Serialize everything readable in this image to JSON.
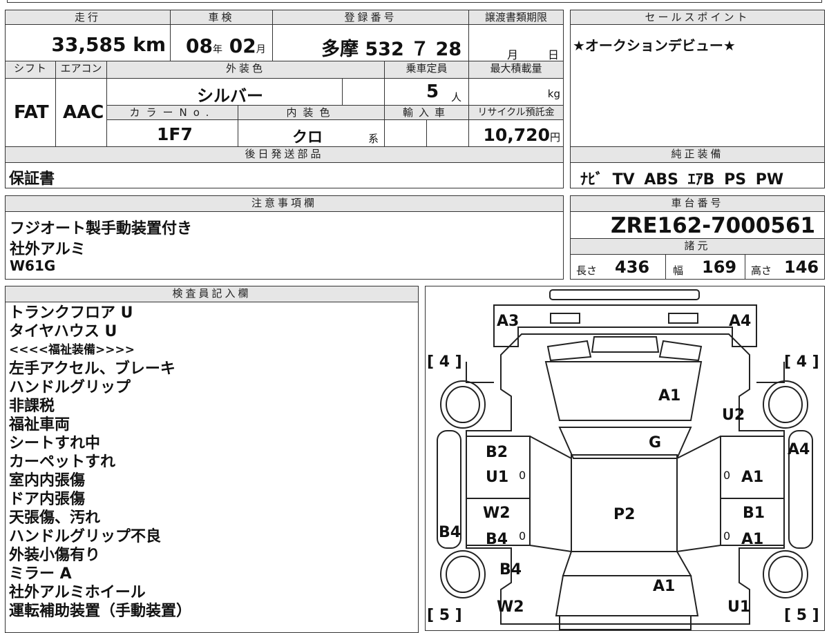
{
  "top": {
    "mileage_label": "走行",
    "mileage": "33,585",
    "mileage_unit": "km",
    "inspection_label": "車検",
    "inspection_year": "08",
    "inspection_year_unit": "年",
    "inspection_month": "02",
    "inspection_month_unit": "月",
    "registration_label": "登録番号",
    "registration": "多摩 532 ７ 28",
    "transfer_label": "譲渡書類期限",
    "transfer_month_unit": "月",
    "transfer_day_unit": "日",
    "sales_label": "セールスポイント",
    "sales_text": "★オークションデビュー★"
  },
  "row2": {
    "shift_label": "シフト",
    "shift": "FAT",
    "ac_label": "エアコン",
    "ac": "AAC",
    "exterior_color_label": "外装色",
    "exterior_color": "シルバー",
    "capacity_label": "乗車定員",
    "capacity": "5",
    "capacity_unit": "人",
    "max_load_label": "最大積載量",
    "max_load_unit": "kg",
    "color_no_label": "カラーNo.",
    "color_no": "1F7",
    "interior_color_label": "内装色",
    "interior_color": "クロ",
    "interior_color_unit": "系",
    "import_label": "輸入車",
    "recycle_label": "リサイクル預託金",
    "recycle": "10,720",
    "recycle_unit": "円"
  },
  "later_parts": {
    "label": "後日発送部品",
    "text": "保証書"
  },
  "equipment": {
    "label": "純正装備",
    "text": "ﾅﾋﾞ TV ABS ｴｱB PS PW"
  },
  "notes": {
    "label": "注意事項欄",
    "lines": [
      "フジオート製手動装置付き",
      "社外アルミ",
      "W61G"
    ]
  },
  "chassis": {
    "label": "車台番号",
    "number": "ZRE162-7000561",
    "dims_label": "諸元",
    "length_label": "長さ",
    "length": "436",
    "width_label": "幅",
    "width": "169",
    "height_label": "高さ",
    "height": "146"
  },
  "inspector": {
    "label": "検査員記入欄",
    "lines": [
      "トランクフロア U",
      "タイヤハウス U",
      "<<<<福祉装備>>>>",
      "左手アクセル、ブレーキ",
      "ハンドルグリップ",
      "非課税",
      "福祉車両",
      "シートすれ中",
      "カーペットすれ",
      "室内内張傷",
      "ドア内張傷",
      "天張傷、汚れ",
      "ハンドルグリップ不良",
      "外装小傷有り",
      "ミラー A",
      "社外アルミホイール",
      "運転補助装置（手動装置）"
    ]
  },
  "diagram": {
    "tire_front_left": "[ 4 ]",
    "tire_front_right": "[ 4 ]",
    "tire_rear_left": "[ 5 ]",
    "tire_rear_right": "[ 5 ]",
    "marks": {
      "front_left_corner": "A3",
      "front_right_corner": "A4",
      "hood": "A1",
      "right_front_fender": "U2",
      "windshield": "G",
      "left_front_door_top": "B2",
      "left_front_door_bottom": "U1",
      "left_front_door_zero": "0",
      "right_front_door_zero": "0",
      "right_front_door": "A1",
      "right_side": "A4",
      "roof": "P2",
      "left_rear_door_top": "W2",
      "left_rear_door_bottom": "B4",
      "left_rear_door_zero": "0",
      "left_side": "B4",
      "right_rear_door_top": "B1",
      "right_rear_door_zero": "0",
      "right_rear_door_bottom": "A1",
      "left_rear_fender": "B4",
      "trunk": "A1",
      "left_rear_corner": "W2",
      "right_rear_corner": "U1"
    }
  }
}
